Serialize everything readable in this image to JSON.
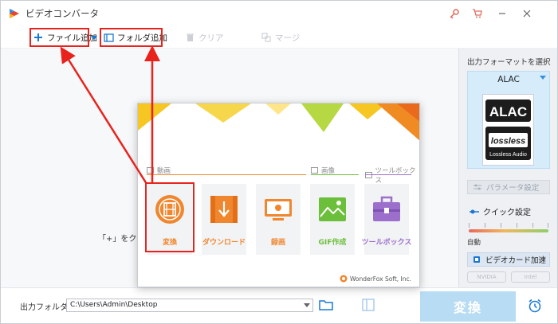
{
  "window": {
    "title": "ビデオコンバータ",
    "icons": [
      "app-logo-icon",
      "key-icon",
      "cart-icon",
      "minimize-icon",
      "close-icon"
    ]
  },
  "toolbar": {
    "add_file": "ファイル追加",
    "add_folder": "フォルダ追加",
    "clear": "クリア",
    "merge": "マージ"
  },
  "main": {
    "add_hint": "「+」をクリッ"
  },
  "dialog": {
    "sections": {
      "video": "動画",
      "image": "画像",
      "toolbox": "ツールボックス"
    },
    "tiles": [
      {
        "label": "変換",
        "icon": "film-icon",
        "color": "#f0862e"
      },
      {
        "label": "ダウンロード",
        "icon": "download-icon",
        "color": "#f0862e"
      },
      {
        "label": "録画",
        "icon": "screen-record-icon",
        "color": "#f0862e"
      },
      {
        "label": "GIF作成",
        "icon": "image-icon",
        "color": "#6cbf3a"
      },
      {
        "label": "ツールボックス",
        "icon": "toolbox-icon",
        "color": "#9b6fcb"
      }
    ],
    "brand": "WonderFox Soft, Inc."
  },
  "right_panel": {
    "title": "出力フォーマットを選択",
    "format": "ALAC",
    "logo_text": "ALAC",
    "logo_sub": "lossless",
    "logo_caption": "Lossless Audio",
    "param_button": "パラメータ設定",
    "quick_setting": "クイック設定",
    "auto_label": "自動",
    "gpu_button": "ビデオカード加速",
    "gpu_chips": [
      "NVIDIA",
      "Intel"
    ]
  },
  "bottom": {
    "output_label": "出力フォルダ：",
    "output_path": "C:\\Users\\Admin\\Desktop",
    "convert": "変換"
  },
  "colors": {
    "accent_blue": "#3a8ee0",
    "annotation_red": "#e8231d",
    "convert_button": "#b8dcf4",
    "orange": "#f0862e"
  }
}
